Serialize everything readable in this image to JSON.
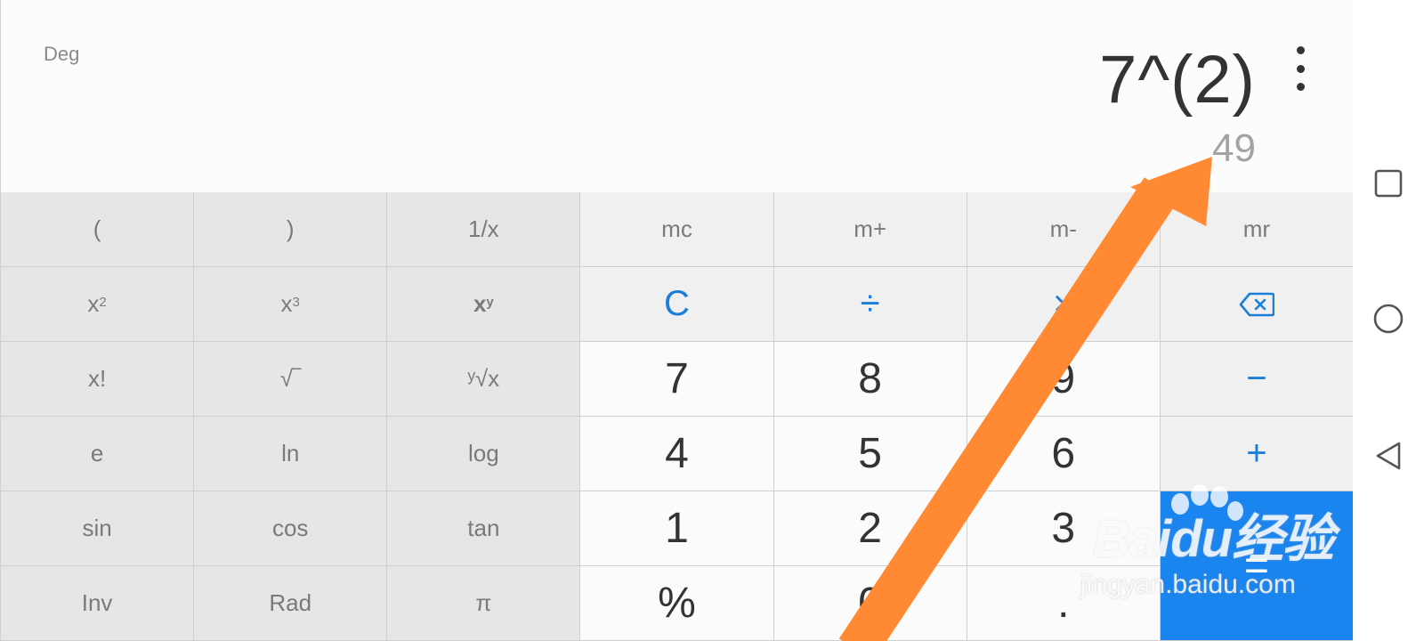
{
  "display": {
    "angle_mode": "Deg",
    "expression": "7^(2)",
    "result": "49"
  },
  "keys": {
    "open_paren": "(",
    "close_paren": ")",
    "reciprocal": "1/x",
    "mc": "mc",
    "m_plus": "m+",
    "m_minus": "m-",
    "mr": "mr",
    "square_base": "x",
    "square_exp": "2",
    "cube_base": "x",
    "cube_exp": "3",
    "power_base": "x",
    "power_exp": "y",
    "clear": "C",
    "divide": "÷",
    "multiply": "×",
    "factorial": "x!",
    "sqrt": "√‾",
    "yroot": "ʸ√x",
    "seven": "7",
    "eight": "8",
    "nine": "9",
    "minus": "−",
    "e": "e",
    "ln": "ln",
    "log": "log",
    "four": "4",
    "five": "5",
    "six": "6",
    "plus": "+",
    "sin": "sin",
    "cos": "cos",
    "tan": "tan",
    "one": "1",
    "two": "2",
    "three": "3",
    "equals": "=",
    "inv": "Inv",
    "rad": "Rad",
    "pi": "π",
    "percent": "%",
    "zero": "0",
    "decimal": "."
  },
  "watermark": {
    "logo": "Baidu经验",
    "url": "jingyan.baidu.com"
  },
  "colors": {
    "accent": "#1a7fd8",
    "equals_bg": "#1a84ef",
    "arrow": "#ff8a33"
  },
  "icons": {
    "backspace": "backspace-icon",
    "more": "more-vertical-icon",
    "recents": "square-icon",
    "home": "circle-icon",
    "back": "triangle-back-icon"
  }
}
